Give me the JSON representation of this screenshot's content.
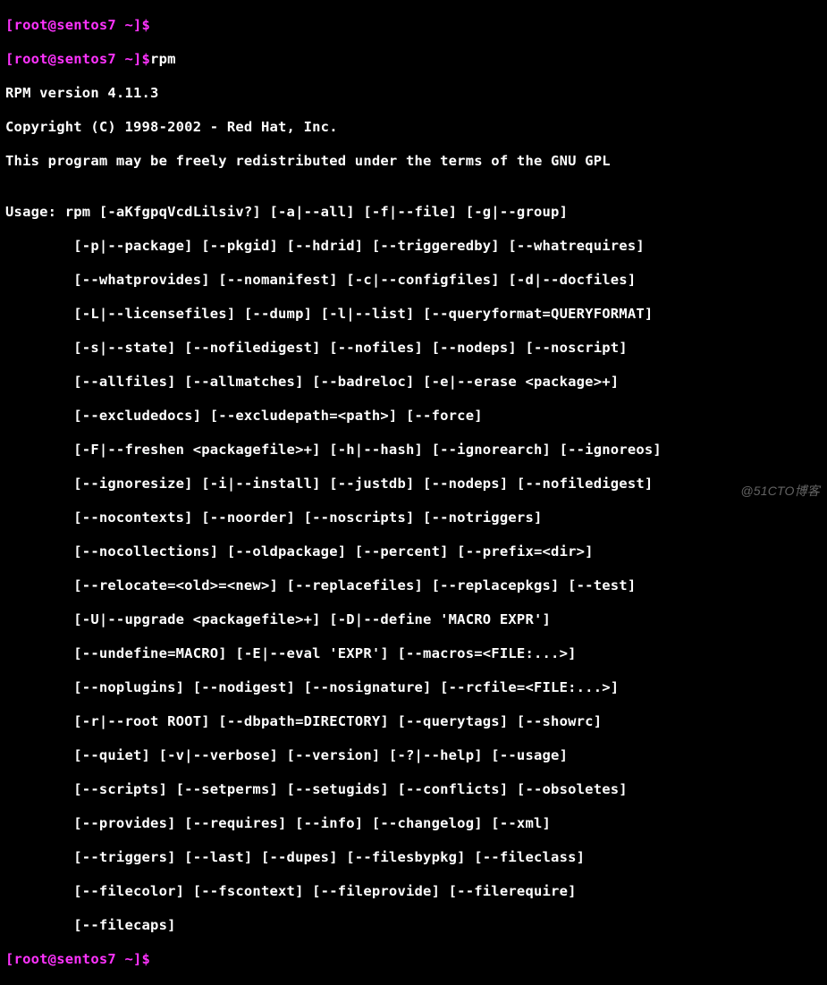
{
  "prompt": {
    "text": "[root@sentos7 ~]$",
    "user": "root",
    "host": "sentos7",
    "cwd": "~"
  },
  "commands": {
    "l0": "",
    "l1": "rpm",
    "last": ""
  },
  "output": {
    "version_line": "RPM version 4.11.3",
    "copyright_line": "Copyright (C) 1998-2002 - Red Hat, Inc.",
    "redistribute_line": "This program may be freely redistributed under the terms of the GNU GPL",
    "blank": "",
    "usage_line": "Usage: rpm [-aKfgpqVcdLilsiv?] [-a|--all] [-f|--file] [-g|--group]",
    "u1": "        [-p|--package] [--pkgid] [--hdrid] [--triggeredby] [--whatrequires]",
    "u2": "        [--whatprovides] [--nomanifest] [-c|--configfiles] [-d|--docfiles]",
    "u3": "        [-L|--licensefiles] [--dump] [-l|--list] [--queryformat=QUERYFORMAT]",
    "u4": "        [-s|--state] [--nofiledigest] [--nofiles] [--nodeps] [--noscript]",
    "u5": "        [--allfiles] [--allmatches] [--badreloc] [-e|--erase <package>+]",
    "u6": "        [--excludedocs] [--excludepath=<path>] [--force]",
    "u7": "        [-F|--freshen <packagefile>+] [-h|--hash] [--ignorearch] [--ignoreos]",
    "u8": "        [--ignoresize] [-i|--install] [--justdb] [--nodeps] [--nofiledigest]",
    "u9": "        [--nocontexts] [--noorder] [--noscripts] [--notriggers]",
    "u10": "        [--nocollections] [--oldpackage] [--percent] [--prefix=<dir>]",
    "u11": "        [--relocate=<old>=<new>] [--replacefiles] [--replacepkgs] [--test]",
    "u12": "        [-U|--upgrade <packagefile>+] [-D|--define 'MACRO EXPR']",
    "u13": "        [--undefine=MACRO] [-E|--eval 'EXPR'] [--macros=<FILE:...>]",
    "u14": "        [--noplugins] [--nodigest] [--nosignature] [--rcfile=<FILE:...>]",
    "u15": "        [-r|--root ROOT] [--dbpath=DIRECTORY] [--querytags] [--showrc]",
    "u16": "        [--quiet] [-v|--verbose] [--version] [-?|--help] [--usage]",
    "u17": "        [--scripts] [--setperms] [--setugids] [--conflicts] [--obsoletes]",
    "u18": "        [--provides] [--requires] [--info] [--changelog] [--xml]",
    "u19": "        [--triggers] [--last] [--dupes] [--filesbypkg] [--fileclass]",
    "u20": "        [--filecolor] [--fscontext] [--fileprovide] [--filerequire]",
    "u21": "        [--filecaps]"
  },
  "watermark": "@51CTO博客"
}
